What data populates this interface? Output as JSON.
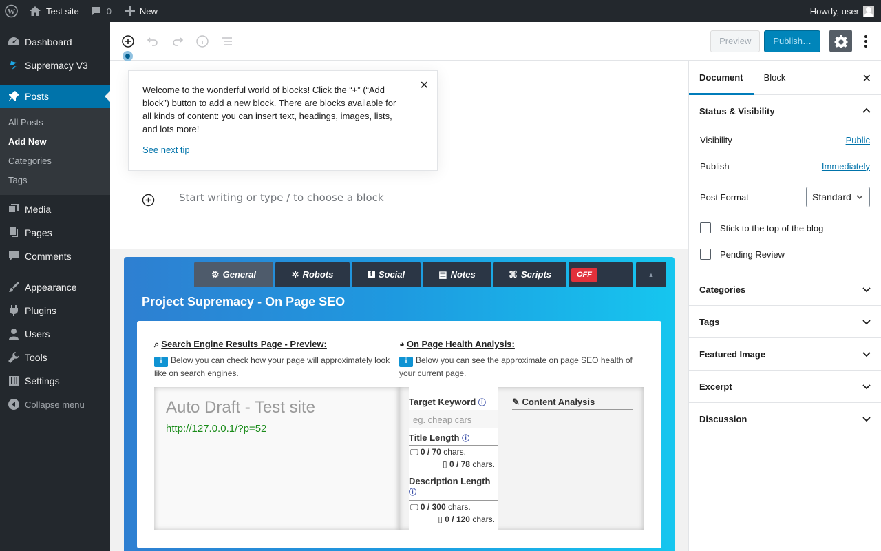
{
  "adminbar": {
    "site": "Test site",
    "comments": "0",
    "new": "New",
    "howdy": "Howdy, user"
  },
  "sidebar": {
    "items": [
      {
        "label": "Dashboard"
      },
      {
        "label": "Supremacy V3"
      },
      {
        "label": "Posts"
      },
      {
        "label": "Media"
      },
      {
        "label": "Pages"
      },
      {
        "label": "Comments"
      },
      {
        "label": "Appearance"
      },
      {
        "label": "Plugins"
      },
      {
        "label": "Users"
      },
      {
        "label": "Tools"
      },
      {
        "label": "Settings"
      }
    ],
    "posts_sub": [
      "All Posts",
      "Add New",
      "Categories",
      "Tags"
    ],
    "collapse": "Collapse menu"
  },
  "header": {
    "preview": "Preview",
    "publish": "Publish…"
  },
  "tip": {
    "text": "Welcome to the wonderful world of blocks! Click the “+” (“Add block”) button to add a new block. There are blocks available for all kinds of content: you can insert text, headings, images, lists, and lots more!",
    "next": "See next tip"
  },
  "editor": {
    "placeholder": "Start writing or type / to choose a block"
  },
  "seo": {
    "tabs": [
      "General",
      "Robots",
      "Social",
      "Notes",
      "Scripts"
    ],
    "off": "OFF",
    "title": "Project Supremacy - On Page SEO",
    "serp_heading": "Search Engine Results Page - Preview:",
    "serp_desc": "Below you can check how your page will approximately look like on search engines.",
    "health_heading": "On Page Health Analysis:",
    "health_desc": "Below you can see the approximate on page SEO health of your current page.",
    "serp_title": "Auto Draft - Test site",
    "serp_url": "http://127.0.0.1/?p=52",
    "target_keyword": "Target Keyword",
    "keyword_placeholder": "eg. cheap cars",
    "title_length": "Title Length",
    "title_desktop": "0 / 70",
    "title_mobile": "0 / 78",
    "chars": "chars.",
    "desc_length": "Description Length",
    "desc_desktop": "0 / 300",
    "desc_mobile": "0 / 120",
    "content_analysis": "Content Analysis"
  },
  "settings": {
    "tabs": [
      "Document",
      "Block"
    ],
    "status_visibility": "Status & Visibility",
    "visibility_label": "Visibility",
    "visibility_value": "Public",
    "publish_label": "Publish",
    "publish_value": "Immediately",
    "post_format_label": "Post Format",
    "post_format_value": "Standard",
    "stick_label": "Stick to the top of the blog",
    "pending_label": "Pending Review",
    "panels": [
      "Categories",
      "Tags",
      "Featured Image",
      "Excerpt",
      "Discussion"
    ]
  },
  "colors": {
    "accent": "#0073aa",
    "admin_bg": "#23282d",
    "off_red": "#e2313b"
  }
}
